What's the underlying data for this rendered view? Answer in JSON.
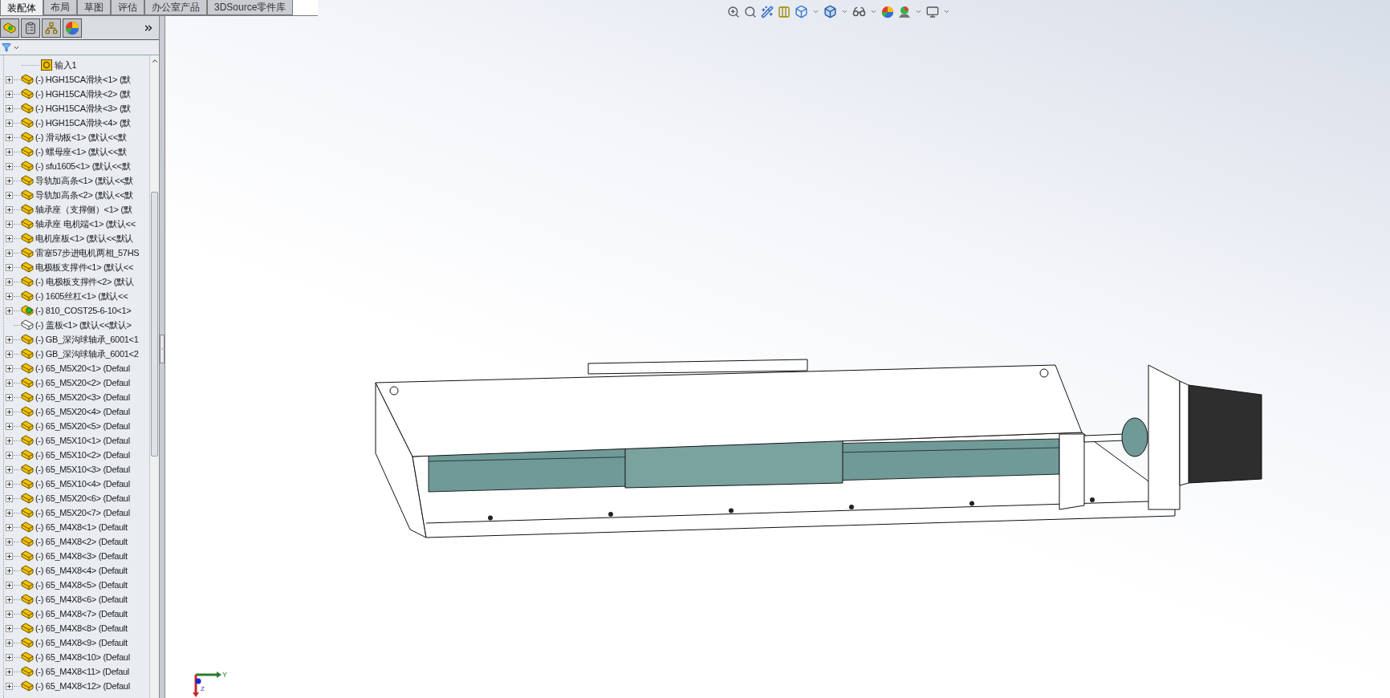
{
  "tabs": [
    {
      "label": "装配体",
      "selected": true
    },
    {
      "label": "布局",
      "selected": false
    },
    {
      "label": "草图",
      "selected": false
    },
    {
      "label": "评估",
      "selected": false
    },
    {
      "label": "办公室产品",
      "selected": false
    },
    {
      "label": "3DSource零件库",
      "selected": false
    }
  ],
  "tree": {
    "items": [
      {
        "label": "输入1",
        "kind": "sketch",
        "expandable": false
      },
      {
        "label": "(-) HGH15CA滑块<1> (默",
        "kind": "part",
        "expandable": true
      },
      {
        "label": "(-) HGH15CA滑块<2> (默",
        "kind": "part",
        "expandable": true
      },
      {
        "label": "(-) HGH15CA滑块<3> (默",
        "kind": "part",
        "expandable": true
      },
      {
        "label": "(-) HGH15CA滑块<4> (默",
        "kind": "part",
        "expandable": true
      },
      {
        "label": "(-) 滑动板<1> (默认<<默",
        "kind": "part",
        "expandable": true
      },
      {
        "label": "(-) 螺母座<1> (默认<<默",
        "kind": "part",
        "expandable": true
      },
      {
        "label": "(-) sfu1605<1> (默认<<默",
        "kind": "part",
        "expandable": true
      },
      {
        "label": "导轨加高条<1> (默认<<默",
        "kind": "part",
        "expandable": true
      },
      {
        "label": "导轨加高条<2> (默认<<默",
        "kind": "part",
        "expandable": true
      },
      {
        "label": "轴承座（支撑侧）<1> (默",
        "kind": "part",
        "expandable": true
      },
      {
        "label": "轴承座 电机端<1> (默认<<",
        "kind": "part",
        "expandable": true
      },
      {
        "label": "电机座板<1> (默认<<默认",
        "kind": "part",
        "expandable": true
      },
      {
        "label": "雷塞57步进电机两相_57HS",
        "kind": "part",
        "expandable": true
      },
      {
        "label": "电极板支撑件<1> (默认<<",
        "kind": "part",
        "expandable": true
      },
      {
        "label": "(-) 电极板支撑件<2> (默认",
        "kind": "part",
        "expandable": true
      },
      {
        "label": "(-) 1605丝杠<1> (默认<<",
        "kind": "part",
        "expandable": true
      },
      {
        "label": "(-) 810_COST25-6-10<1>",
        "kind": "assembly",
        "expandable": true
      },
      {
        "label": "(-) 盖板<1> (默认<<默认>",
        "kind": "hidden",
        "expandable": false
      },
      {
        "label": "(-) GB_深沟球轴承_6001<1",
        "kind": "part",
        "expandable": true
      },
      {
        "label": "(-) GB_深沟球轴承_6001<2",
        "kind": "part",
        "expandable": true
      },
      {
        "label": "(-) 65_M5X20<1> (Defaul",
        "kind": "part",
        "expandable": true
      },
      {
        "label": "(-) 65_M5X20<2> (Defaul",
        "kind": "part",
        "expandable": true
      },
      {
        "label": "(-) 65_M5X20<3> (Defaul",
        "kind": "part",
        "expandable": true
      },
      {
        "label": "(-) 65_M5X20<4> (Defaul",
        "kind": "part",
        "expandable": true
      },
      {
        "label": "(-) 65_M5X20<5> (Defaul",
        "kind": "part",
        "expandable": true
      },
      {
        "label": "(-) 65_M5X10<1> (Defaul",
        "kind": "part",
        "expandable": true
      },
      {
        "label": "(-) 65_M5X10<2> (Defaul",
        "kind": "part",
        "expandable": true
      },
      {
        "label": "(-) 65_M5X10<3> (Defaul",
        "kind": "part",
        "expandable": true
      },
      {
        "label": "(-) 65_M5X10<4> (Defaul",
        "kind": "part",
        "expandable": true
      },
      {
        "label": "(-) 65_M5X20<6> (Defaul",
        "kind": "part",
        "expandable": true
      },
      {
        "label": "(-) 65_M5X20<7> (Defaul",
        "kind": "part",
        "expandable": true
      },
      {
        "label": "(-) 65_M4X8<1> (Default",
        "kind": "part",
        "expandable": true
      },
      {
        "label": "(-) 65_M4X8<2> (Default",
        "kind": "part",
        "expandable": true
      },
      {
        "label": "(-) 65_M4X8<3> (Default",
        "kind": "part",
        "expandable": true
      },
      {
        "label": "(-) 65_M4X8<4> (Default",
        "kind": "part",
        "expandable": true
      },
      {
        "label": "(-) 65_M4X8<5> (Default",
        "kind": "part",
        "expandable": true
      },
      {
        "label": "(-) 65_M4X8<6> (Default",
        "kind": "part",
        "expandable": true
      },
      {
        "label": "(-) 65_M4X8<7> (Default",
        "kind": "part",
        "expandable": true
      },
      {
        "label": "(-) 65_M4X8<8> (Default",
        "kind": "part",
        "expandable": true
      },
      {
        "label": "(-) 65_M4X8<9> (Default",
        "kind": "part",
        "expandable": true
      },
      {
        "label": "(-) 65_M4X8<10> (Defaul",
        "kind": "part",
        "expandable": true
      },
      {
        "label": "(-) 65_M4X8<11> (Defaul",
        "kind": "part",
        "expandable": true
      },
      {
        "label": "(-) 65_M4X8<12> (Defaul",
        "kind": "part",
        "expandable": true
      }
    ]
  },
  "triad": {
    "y_label": "Y",
    "z_label": "Z"
  }
}
